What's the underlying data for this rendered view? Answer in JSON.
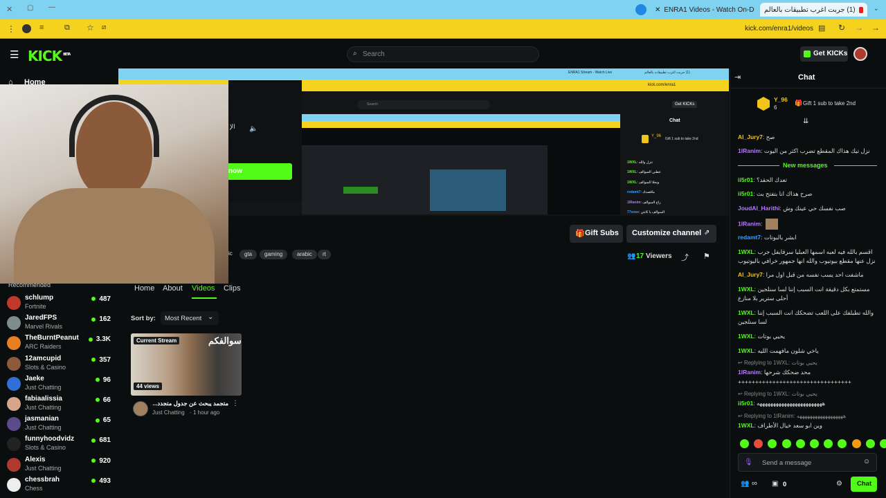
{
  "browser": {
    "tabs": [
      {
        "title": "ENRA1 Videos - Watch On-Demand"
      },
      {
        "title": "(1) جربت اغرب تطبيقات بالعالم"
      }
    ],
    "url": "kick.com/enra1/videos"
  },
  "header": {
    "logo": "KICK",
    "logo_badge": "BETA",
    "search_placeholder": "Search",
    "get_kicks": "Get KICKs"
  },
  "sidebar": {
    "home": "Home",
    "recommended": "Recommended",
    "channels": [
      {
        "name": "schlump",
        "category": "Fortnite",
        "viewers": "487",
        "color": "#c0392b"
      },
      {
        "name": "JaredFPS",
        "category": "Marvel Rivals",
        "viewers": "162",
        "color": "#7f8c8d"
      },
      {
        "name": "TheBurntPeanut",
        "category": "ARC Raiders",
        "viewers": "3.3K",
        "color": "#e67e22"
      },
      {
        "name": "12amcupid",
        "category": "Slots & Casino",
        "viewers": "357",
        "color": "#8e5a3c"
      },
      {
        "name": "Jaeke",
        "category": "Just Chatting",
        "viewers": "96",
        "color": "#2f6fd6"
      },
      {
        "name": "fabiaalissia",
        "category": "Just Chatting",
        "viewers": "66",
        "color": "#d6a58a"
      },
      {
        "name": "jasmanian",
        "category": "Just Chatting",
        "viewers": "65",
        "color": "#5b4b8a"
      },
      {
        "name": "funnyhoodvidz",
        "category": "Slots & Casino",
        "viewers": "681",
        "color": "#222222"
      },
      {
        "name": "Alexis",
        "category": "Just Chatting",
        "viewers": "920",
        "color": "#b03a2e"
      },
      {
        "name": "chessbrah",
        "category": "Chess",
        "viewers": "493",
        "color": "#eeeeee"
      }
    ]
  },
  "channel": {
    "gift_subs": "Gift Subs",
    "customize": "Customize channel",
    "tags": [
      "gta",
      "gaming",
      "arabic",
      "rt"
    ],
    "tag_partial": "ic",
    "viewers_count": "17",
    "viewers_label": "Viewers",
    "nav": [
      "Home",
      "About",
      "Videos",
      "Clips"
    ],
    "sort_label": "Sort by:",
    "sort_value": "Most Recent",
    "overlay_button": "now",
    "overlay_text": "الإ"
  },
  "video": {
    "badge": "Current Stream",
    "views": "44 views",
    "thumb_text": "سوالفكم",
    "title": "متجمد يبحث عن جدول متجدد...",
    "category": "Just Chatting",
    "age": "1 hour ago"
  },
  "inner_capture": {
    "search": "Search",
    "get_kicks": "Get KICKs",
    "chat": "Chat",
    "top_user": "Y_96",
    "gift": "Gift 1 sub to take 2nd",
    "url": "kick.com/enra1",
    "tab1": "ENRA1 Stream - Watch Live",
    "tab2": "(1) جربت اغرب تطبيقات بالعالم",
    "lines": [
      {
        "user": "1WXL",
        "text": "تنزل والله",
        "color": "#53fc18"
      },
      {
        "user": "1WXL",
        "text": "عطني السوالف",
        "color": "#53fc18"
      },
      {
        "user": "1WXL",
        "text": "وبحلا السوالف",
        "color": "#53fc18"
      },
      {
        "user": "redamt7",
        "text": "ماقصدك",
        "color": "#3aa0ff"
      },
      {
        "user": "1lRanim",
        "text": "راح السوالف",
        "color": "#b57bff"
      },
      {
        "user": "77soss",
        "text": "السوالف يا كابتن",
        "color": "#3aa0ff"
      }
    ]
  },
  "chat": {
    "title": "Chat",
    "leader": {
      "name": "Y_96",
      "rank": "6",
      "gift": "Gift 1 sub to take 2nd"
    },
    "new_messages": "New messages",
    "messages": [
      {
        "user": "Al_Jury7",
        "text": "صح",
        "color": "#f0c419"
      },
      {
        "user": "1lRanim",
        "text": "نزل تيك هذاك المقطع تضرب اكثر من اليوت",
        "color": "#b57bff"
      },
      {
        "user": "ii5r01",
        "text": "تعدك الحقد؟",
        "color": "#53fc18"
      },
      {
        "user": "ii5r01",
        "text": "صرح هذاك انا بتفتح بث",
        "color": "#53fc18"
      },
      {
        "user": "JoudAl_Harithi",
        "text": "صب نفسك حي عينك وش",
        "color": "#b57bff"
      },
      {
        "user": "1lRanim",
        "text": "",
        "color": "#b57bff"
      },
      {
        "user": "redamt7",
        "text": "ابشر بالبوتات",
        "color": "#3aa0ff"
      },
      {
        "user": "1WXL",
        "text": "اقسم بالله فيه لعبه اسمها العبليا سرفايفل جرب نزل عنها مقطع بيوتيوب والله انها جمهور خرافي باليوتيوب",
        "color": "#53fc18"
      },
      {
        "user": "Al_Jury7",
        "text": "ماشفت احد يسب نفسه من قبل اول مرا",
        "color": "#f0c419"
      },
      {
        "user": "1WXL",
        "text": "مستمتع بكل دقيقة انت السبب إننا لسا سنلجين أحلى سترير بلا منازع",
        "color": "#53fc18"
      },
      {
        "user": "1WXL",
        "text": "والله تطبلفك على اللعب تضحكك انت السبب إننا لسا سنلجين",
        "color": "#53fc18"
      },
      {
        "user": "1WXL",
        "text": "يحيي بوتات",
        "color": "#53fc18"
      },
      {
        "user": "1WXL",
        "text": "ياخي شلون مافهمت الليه",
        "color": "#53fc18"
      }
    ],
    "replies": [
      {
        "replying": "Replying to 1WXL:",
        "quote": "يحيي بوتات",
        "user": "1lRanim",
        "text": "محد ضحكك شرحها",
        "color": "#b57bff"
      },
      {
        "replying": "Replying to 1WXL:",
        "quote": "يحيي بوتات",
        "user": "ii5r01",
        "text": "ههههههههههههههههههههههههه",
        "color": "#53fc18"
      },
      {
        "replying": "Replying to 1lRanim:",
        "quote": "ههههههههههههههههههه",
        "user": "1WXL",
        "text": "وين ابو سعد خيال الأطراف",
        "color": "#53fc18"
      }
    ],
    "tail": "+++++++++++++++++++++++++++++++++",
    "emote_colors": [
      "#53fc18",
      "#e74c3c",
      "#53fc18",
      "#53fc18",
      "#53fc18",
      "#53fc18",
      "#53fc18",
      "#53fc18",
      "#f39c12",
      "#53fc18",
      "#53fc18"
    ],
    "input_placeholder": "Send a message",
    "points": "0",
    "send": "Chat"
  }
}
